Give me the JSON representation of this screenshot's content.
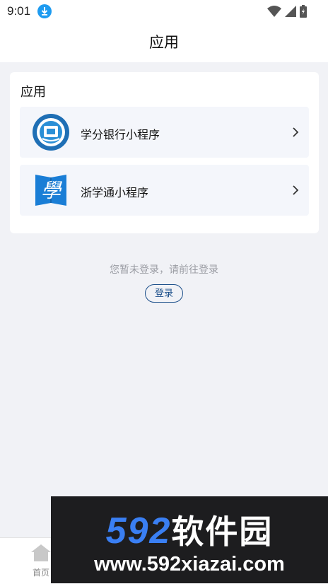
{
  "status": {
    "time": "9:01"
  },
  "header": {
    "title": "应用"
  },
  "card": {
    "title": "应用",
    "items": [
      {
        "label": "学分银行小程序",
        "icon": "credit-bank-icon"
      },
      {
        "label": "浙学通小程序",
        "icon": "xue-logo-icon"
      }
    ]
  },
  "empty": {
    "message": "您暂未登录，请前往登录",
    "login_label": "登录"
  },
  "tabbar": {
    "home_label": "首页"
  },
  "watermark": {
    "brand_num": "592",
    "brand_cn": "软件园",
    "url": "www.592xiazai.com"
  }
}
